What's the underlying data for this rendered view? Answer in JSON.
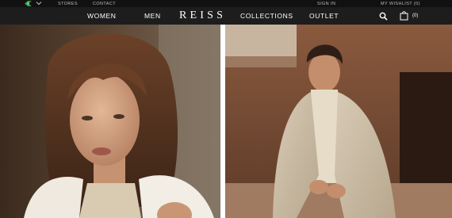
{
  "utility_bar": {
    "stores_label": "STORES",
    "contact_label": "CONTACT",
    "sign_in_label": "SIGN IN",
    "wishlist_label": "MY WISHLIST (0)"
  },
  "nav": {
    "brand": "REISS",
    "links": [
      "WOMEN",
      "MEN",
      "COLLECTIONS",
      "OUTLET"
    ],
    "bag_count": "(0)"
  },
  "colors": {
    "utility_bg": "#111111",
    "nav_bg": "#1d1d1d",
    "nav_text": "#ffffff"
  },
  "icons": [
    "flag-icon",
    "chevron-down-icon",
    "search-icon",
    "shopping-bag-icon"
  ]
}
